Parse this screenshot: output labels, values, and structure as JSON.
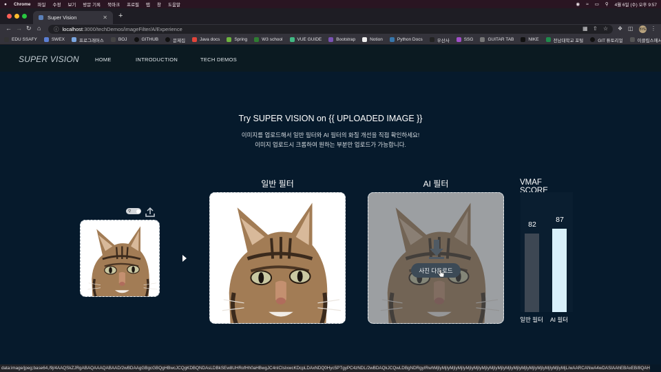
{
  "menubar": {
    "items": [
      "Chrome",
      "파일",
      "수정",
      "보기",
      "방문 기록",
      "북마크",
      "프로필",
      "탭",
      "창",
      "도움말"
    ],
    "datetime": "4월 6일 (수) 오후 9:57"
  },
  "browser": {
    "tab_title": "Super Vision",
    "url_host": "localhost",
    "url_path": ":3000/techDemos/imageFilter/A/Experience",
    "profile_initials": "BYE",
    "bookmarks": [
      "EDU SSAFY",
      "SWEX",
      "프로그래머스",
      "BOJ",
      "GITHUB",
      "문제집",
      "Java docs",
      "Spring",
      "W3 school",
      "VUE GUIDE",
      "Bootstrap",
      "Notion",
      "Python Docs",
      "우산사",
      "SSG",
      "GUITAR TAB",
      "NIKE",
      "전남대학교 포털",
      "GIT 튜토리얼",
      "이클립스에서 GIT 활용"
    ],
    "status_url": "data:image/jpeg;base64,/9j/4AAQSkZJRgABAQAAAQABAAD/2wBDAAgGBgcGBQgHBwcJCQgKDBQNDAsLDBkSEw8UHRofHh0aHBwgJC4nICIsIxwcKDcpLDAxNDQ0Hyc5PTgyPC4zNDL/2wBDAQkJCQwLDBgNDRgyIRwhMjIyMjIyMjIyMjIyMjIyMjIyMjIyMjIyMjIyMjIyMjIyMjIyMjIyMjIyMjIyMjIyMjL/wAARCANwA4wDASIAAhEBAxEB/8QAHwAA"
  },
  "site_nav": {
    "logo": "SUPER VISION",
    "links": [
      "HOME",
      "INTRODUCTION",
      "TECH DEMOS"
    ]
  },
  "hero": {
    "title": "Try SUPER VISION on {{ UPLOADED IMAGE }}",
    "line1": "이미지를 업로드해서 일반 필터와 AI 필터의 화질 개선을 직접 확인하세요!",
    "line2": "이미지 업로드시 크롭하여 원하는 부분만 업로드가 가능합니다."
  },
  "panels": {
    "normal_title": "일반 필터",
    "ai_title": "AI 필터",
    "download_label": "사진 다운로드"
  },
  "vmaf": {
    "title": "VMAF SCORE",
    "scale_max": 100,
    "bars": [
      {
        "label": "일반 필터",
        "value": 82,
        "color": "#3d4753"
      },
      {
        "label": "AI 필터",
        "value": 87,
        "color": "#d8f0fb"
      }
    ]
  },
  "icons": {
    "zoom_toggle": "magnifier-toggle-icon",
    "upload": "upload-icon",
    "arrow": "arrow-right-icon",
    "download": "download-icon"
  }
}
